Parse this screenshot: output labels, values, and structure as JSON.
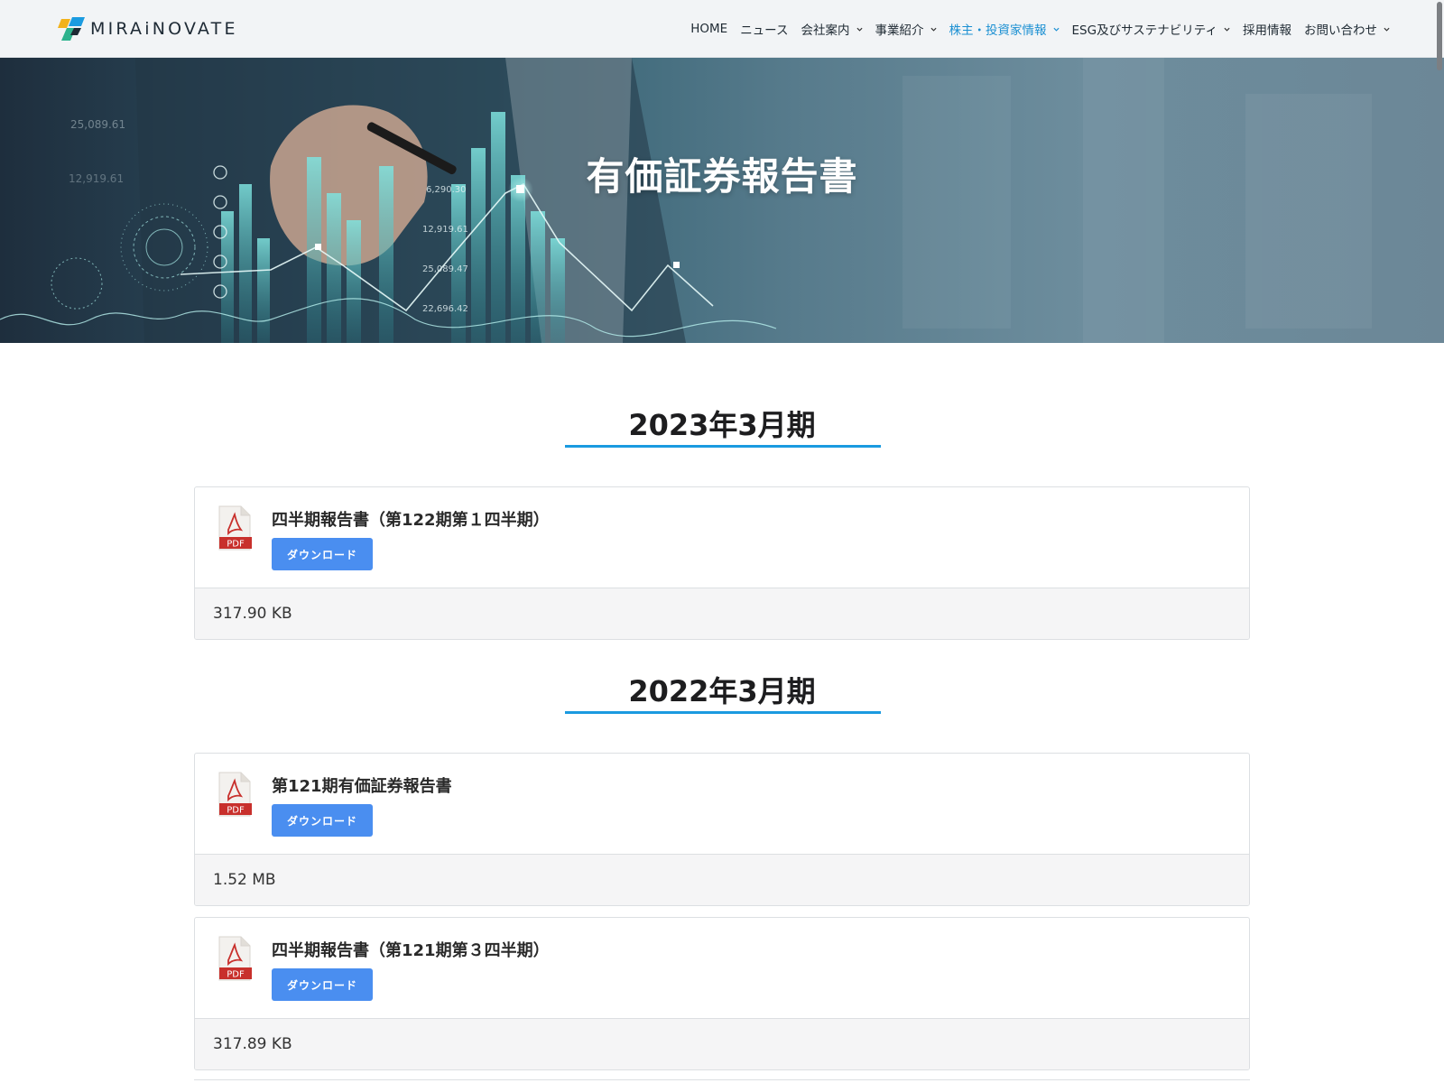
{
  "header": {
    "logo_text": "MIRAiNOVATE",
    "nav": [
      {
        "label": "HOME",
        "dropdown": false,
        "active": false
      },
      {
        "label": "ニュース",
        "dropdown": false,
        "active": false
      },
      {
        "label": "会社案内",
        "dropdown": true,
        "active": false
      },
      {
        "label": "事業紹介",
        "dropdown": true,
        "active": false
      },
      {
        "label": "株主・投資家情報",
        "dropdown": true,
        "active": true
      },
      {
        "label": "ESG及びサステナビリティ",
        "dropdown": true,
        "active": false
      },
      {
        "label": "採用情報",
        "dropdown": false,
        "active": false
      },
      {
        "label": "お問い合わせ",
        "dropdown": true,
        "active": false
      }
    ]
  },
  "hero": {
    "title": "有価証券報告書",
    "figures": [
      "6,290.30",
      "12,919.61",
      "25,089.47",
      "22,696.42",
      "25,089.61",
      "12,919.61"
    ]
  },
  "sections": [
    {
      "heading": "2023年3月期",
      "documents": [
        {
          "title": "四半期報告書（第122期第１四半期）",
          "button": "ダウンロード",
          "size": "317.90 KB",
          "icon_label": "PDF"
        }
      ]
    },
    {
      "heading": "2022年3月期",
      "documents": [
        {
          "title": "第121期有価証券報告書",
          "button": "ダウンロード",
          "size": "1.52 MB",
          "icon_label": "PDF"
        },
        {
          "title": "四半期報告書（第121期第３四半期）",
          "button": "ダウンロード",
          "size": "317.89 KB",
          "icon_label": "PDF"
        }
      ]
    }
  ],
  "colors": {
    "accent": "#1a9ae0",
    "nav_active": "#1a8fd2",
    "button": "#4a8ef0",
    "pdf_red": "#c8302c"
  }
}
